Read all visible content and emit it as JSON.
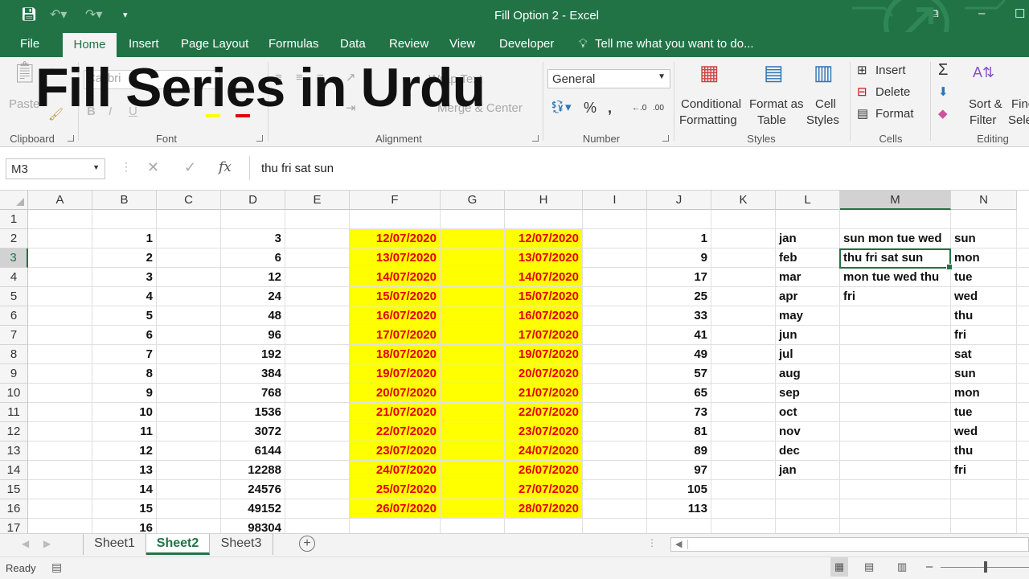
{
  "window": {
    "title": "Fill Option 2 - Excel",
    "restore_icon": "ribbon-display-icon",
    "minimize": "–",
    "maximize": "☐"
  },
  "quick_access": {
    "save_icon": "save-icon",
    "undo_icon": "undo-icon",
    "redo_icon": "redo-icon",
    "customize_icon": "customize-qat-icon"
  },
  "tabs": [
    "File",
    "Home",
    "Insert",
    "Page Layout",
    "Formulas",
    "Data",
    "Review",
    "View",
    "Developer"
  ],
  "tell_me": "Tell me what you want to do...",
  "overlay_title": "Fill Series in Urdu",
  "ribbon": {
    "clipboard": {
      "paste": "Paste",
      "label": "Clipboard"
    },
    "font": {
      "name": "Calibri",
      "label": "Font",
      "bold": "B",
      "italic": "I",
      "underline": "U"
    },
    "alignment": {
      "wrap": "Wrap Text",
      "merge": "Merge & Center",
      "label": "Alignment"
    },
    "number": {
      "format": "General",
      "percent": "%",
      "comma": ",",
      "label": "Number"
    },
    "styles": {
      "conditional": "Conditional",
      "formatting": "Formatting",
      "format_as": "Format as",
      "table": "Table",
      "cell": "Cell",
      "cell_styles": "Styles",
      "label": "Styles"
    },
    "cells": {
      "insert": "Insert",
      "delete": "Delete",
      "format": "Format",
      "label": "Cells"
    },
    "editing": {
      "sum": "Σ",
      "sort": "Sort &",
      "filter": "Filter",
      "find": "Find",
      "select": "Sele",
      "label": "Editing"
    }
  },
  "formula_bar": {
    "name_box": "M3",
    "fx": "fx",
    "cancel": "✕",
    "enter": "✓",
    "content": "thu fri sat sun"
  },
  "columns": [
    "A",
    "B",
    "C",
    "D",
    "E",
    "F",
    "G",
    "H",
    "I",
    "J",
    "K",
    "L",
    "M",
    "N"
  ],
  "rows": [
    "1",
    "2",
    "3",
    "4",
    "5",
    "6",
    "7",
    "8",
    "9",
    "10",
    "11",
    "12",
    "13",
    "14",
    "15",
    "16",
    "17"
  ],
  "col_B": [
    "1",
    "2",
    "3",
    "4",
    "5",
    "6",
    "7",
    "8",
    "9",
    "10",
    "11",
    "12",
    "13",
    "14",
    "15",
    "16"
  ],
  "col_D": [
    "3",
    "6",
    "12",
    "24",
    "48",
    "96",
    "192",
    "384",
    "768",
    "1536",
    "3072",
    "6144",
    "12288",
    "24576",
    "49152",
    "98304"
  ],
  "col_F": [
    "12/07/2020",
    "13/07/2020",
    "14/07/2020",
    "15/07/2020",
    "16/07/2020",
    "17/07/2020",
    "18/07/2020",
    "19/07/2020",
    "20/07/2020",
    "21/07/2020",
    "22/07/2020",
    "23/07/2020",
    "24/07/2020",
    "25/07/2020",
    "26/07/2020"
  ],
  "col_H": [
    "12/07/2020",
    "13/07/2020",
    "14/07/2020",
    "15/07/2020",
    "16/07/2020",
    "17/07/2020",
    "19/07/2020",
    "20/07/2020",
    "21/07/2020",
    "22/07/2020",
    "23/07/2020",
    "24/07/2020",
    "26/07/2020",
    "27/07/2020",
    "28/07/2020"
  ],
  "col_J": [
    "1",
    "9",
    "17",
    "25",
    "33",
    "41",
    "49",
    "57",
    "65",
    "73",
    "81",
    "89",
    "97",
    "105",
    "113"
  ],
  "col_L": [
    "jan",
    "feb",
    "mar",
    "apr",
    "may",
    "jun",
    "jul",
    "aug",
    "sep",
    "oct",
    "nov",
    "dec",
    "jan"
  ],
  "col_M": [
    "sun mon tue wed",
    "thu fri sat sun",
    "mon tue wed thu",
    "fri"
  ],
  "col_N": [
    "sun",
    "mon",
    "tue",
    "wed",
    "thu",
    "fri",
    "sat",
    "sun",
    "mon",
    "tue",
    "wed",
    "thu",
    "fri"
  ],
  "sheets": [
    "Sheet1",
    "Sheet2",
    "Sheet3"
  ],
  "active_sheet": "Sheet2",
  "status": {
    "ready": "Ready",
    "zoom_minus": "–"
  }
}
